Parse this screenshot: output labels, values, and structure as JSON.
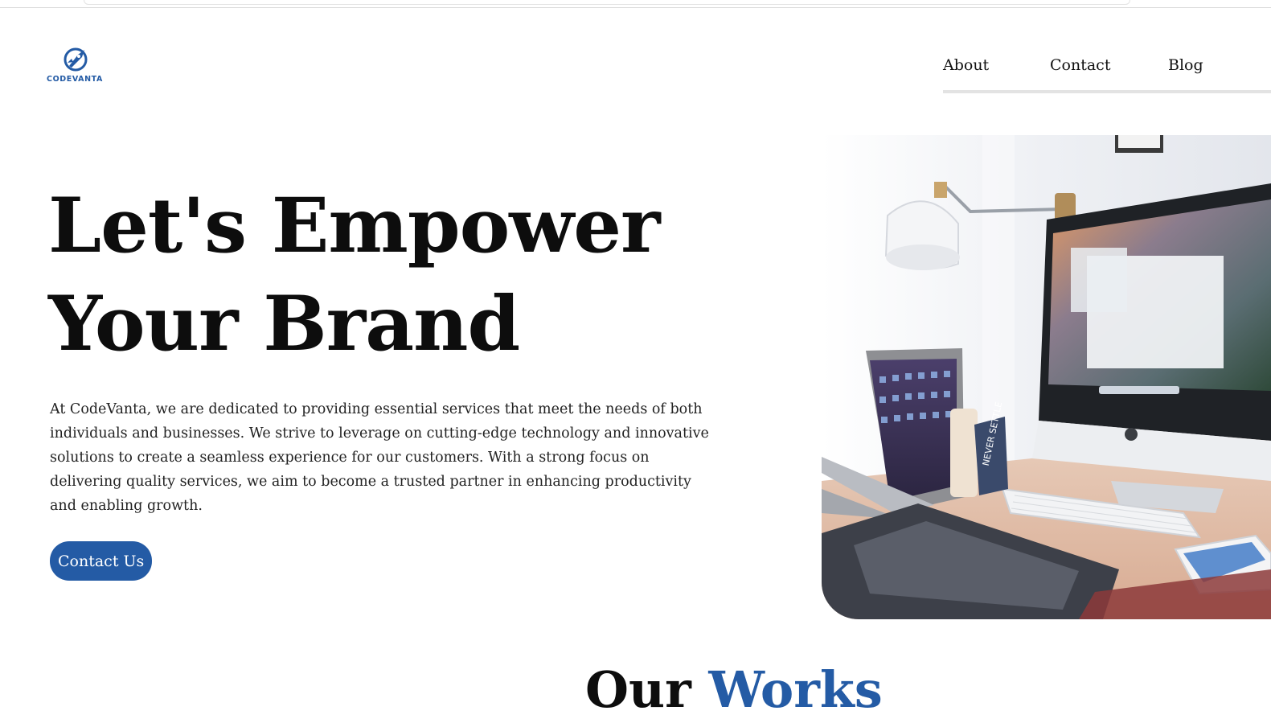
{
  "brand": {
    "name": "CODEVANTA",
    "logo_icon": "rocket-compass-icon",
    "color": "#245ba5"
  },
  "nav": {
    "items": [
      {
        "label": "About"
      },
      {
        "label": "Contact"
      },
      {
        "label": "Blog"
      }
    ]
  },
  "hero": {
    "title_line1": "Let's Empower",
    "title_line2": "Your Brand",
    "description": "At CodeVanta, we are dedicated to providing essential services that meet the needs of both individuals and businesses. We strive to leverage on cutting-edge technology and innovative solutions to create a seamless experience for our customers. With a strong focus on delivering quality services, we aim to become a trusted partner in enhancing productivity and enabling growth.",
    "cta_label": "Contact Us",
    "image": "desk-workspace-photo"
  },
  "works": {
    "title_part1": "Our",
    "title_part2": "Works"
  },
  "colors": {
    "accent": "#245ba5",
    "text": "#0d0d0d",
    "background": "#ffffff"
  }
}
